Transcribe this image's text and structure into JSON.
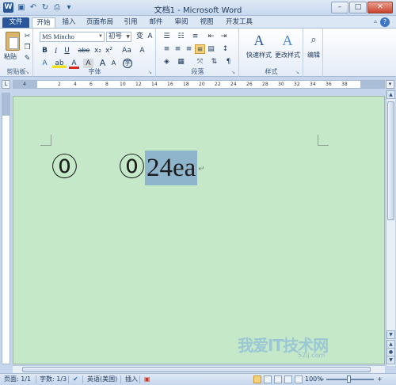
{
  "window": {
    "title": "文档1 - Microsoft Word",
    "minimize_icon": "minimize-icon",
    "maximize_icon": "maximize-icon",
    "close_icon": "close-icon"
  },
  "quick_access": {
    "icons": [
      "word-app-icon",
      "save-icon",
      "undo-icon",
      "redo-icon",
      "print-preview-icon",
      "customize-icon"
    ]
  },
  "tabs": {
    "file": "文件",
    "home": "开始",
    "insert": "插入",
    "layout": "页面布局",
    "references": "引用",
    "mailings": "邮件",
    "review": "审阅",
    "view": "视图",
    "developer": "开发工具",
    "active": "开始"
  },
  "ribbon": {
    "clipboard": {
      "paste": "粘贴",
      "label": "剪贴板"
    },
    "font": {
      "name": "MS Mincho",
      "size": "初号",
      "label": "字体",
      "buttons": {
        "bold": "B",
        "italic": "I",
        "underline": "U",
        "strike": "abe",
        "subscript": "x₂",
        "superscript": "x²",
        "change_case": "Aa",
        "grow": "A",
        "shrink": "A",
        "clear": "A",
        "phonetic": "变",
        "enclosed": "字",
        "char_border": "A",
        "char_shading": "A",
        "effects": "A",
        "highlight": "ab",
        "font_color": "A"
      }
    },
    "paragraph": {
      "label": "段落"
    },
    "styles": {
      "quick": "快速样式",
      "change": "更改样式",
      "label": "样式",
      "icon_text": "A"
    },
    "editing": {
      "label": "编辑"
    }
  },
  "document": {
    "text_first": "⓪",
    "text_second": "⓪",
    "selected_text": "24ea",
    "paragraph_mark": "↵",
    "background_color": "#c5e8c9",
    "selection_color": "#8fb5cc"
  },
  "ruler": {
    "ticks": [
      "4",
      "2",
      "2",
      "4",
      "6",
      "8",
      "10",
      "12",
      "14",
      "16",
      "18",
      "20",
      "22",
      "24",
      "26",
      "28",
      "30",
      "32",
      "34",
      "36",
      "38"
    ]
  },
  "status": {
    "page": "页面: 1/1",
    "words": "字数: 1/3",
    "language": "英语(美国)",
    "mode": "插入",
    "zoom": "100%",
    "zoom_minus": "−",
    "zoom_plus": "+"
  },
  "watermark": {
    "text": "我爱IT技术网",
    "sub": "52ij.com"
  }
}
